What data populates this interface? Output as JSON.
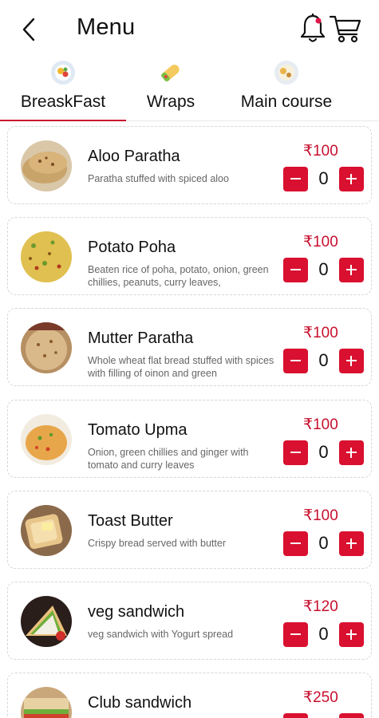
{
  "header": {
    "title": "Menu",
    "back_icon": "chevron-left-icon",
    "notification_icon": "bell-icon",
    "cart_icon": "cart-icon"
  },
  "tabs": [
    {
      "label": "BreaskFast",
      "icon": "breakfast-plate-icon",
      "active": true
    },
    {
      "label": "Wraps",
      "icon": "wrap-roll-icon",
      "active": false
    },
    {
      "label": "Main course",
      "icon": "main-course-plate-icon",
      "active": false
    }
  ],
  "items": [
    {
      "name": "Aloo Paratha",
      "desc": "Paratha stuffed with spiced aloo",
      "price": "₹100",
      "qty": "0",
      "image": "aloo-paratha-photo"
    },
    {
      "name": "Potato Poha",
      "desc": "Beaten rice of poha, potato, onion, green chillies, peanuts, curry leaves,",
      "price": "₹100",
      "qty": "0",
      "image": "potato-poha-photo"
    },
    {
      "name": "Mutter Paratha",
      "desc": "Whole wheat flat bread stuffed with spices with filling of oinon and green",
      "price": "₹100",
      "qty": "0",
      "image": "mutter-paratha-photo"
    },
    {
      "name": "Tomato Upma",
      "desc": "Onion, green chillies and ginger with tomato and curry leaves",
      "price": "₹100",
      "qty": "0",
      "image": "tomato-upma-photo"
    },
    {
      "name": "Toast Butter",
      "desc": "Crispy bread served with butter",
      "price": "₹100",
      "qty": "0",
      "image": "toast-butter-photo"
    },
    {
      "name": "veg sandwich",
      "desc": "veg sandwich with Yogurt spread",
      "price": "₹120",
      "qty": "0",
      "image": "veg-sandwich-photo"
    },
    {
      "name": "Club sandwich",
      "desc": "",
      "price": "₹250",
      "qty": "0",
      "image": "club-sandwich-photo"
    }
  ],
  "colors": {
    "accent": "#c8102e",
    "button": "#d9102f",
    "card_border": "#d6d6d6",
    "desc_text": "#666666"
  }
}
